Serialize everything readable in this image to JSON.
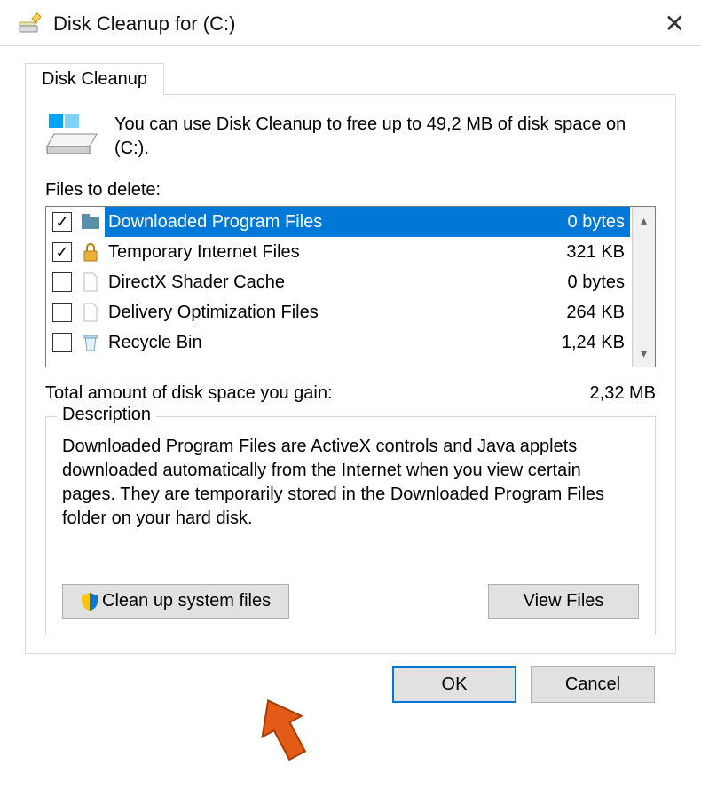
{
  "titlebar": {
    "title": "Disk Cleanup for  (C:)"
  },
  "tab": {
    "label": "Disk Cleanup"
  },
  "intro_text": "You can use Disk Cleanup to free up to 49,2 MB of disk space on  (C:).",
  "files_to_delete_label": "Files to delete:",
  "files": [
    {
      "checked": true,
      "selected": true,
      "icon": "folder-blue",
      "name": "Downloaded Program Files",
      "size": "0 bytes"
    },
    {
      "checked": true,
      "selected": false,
      "icon": "lock",
      "name": "Temporary Internet Files",
      "size": "321 KB"
    },
    {
      "checked": false,
      "selected": false,
      "icon": "page",
      "name": "DirectX Shader Cache",
      "size": "0 bytes"
    },
    {
      "checked": false,
      "selected": false,
      "icon": "page",
      "name": "Delivery Optimization Files",
      "size": "264 KB"
    },
    {
      "checked": false,
      "selected": false,
      "icon": "recycle-bin",
      "name": "Recycle Bin",
      "size": "1,24 KB"
    }
  ],
  "total": {
    "label": "Total amount of disk space you gain:",
    "value": "2,32 MB"
  },
  "description": {
    "title": "Description",
    "text": "Downloaded Program Files are ActiveX controls and Java applets downloaded automatically from the Internet when you view certain pages. They are temporarily stored in the Downloaded Program Files folder on your hard disk."
  },
  "buttons": {
    "clean_up_system_files": "Clean up system files",
    "view_files": "View Files",
    "ok": "OK",
    "cancel": "Cancel"
  }
}
